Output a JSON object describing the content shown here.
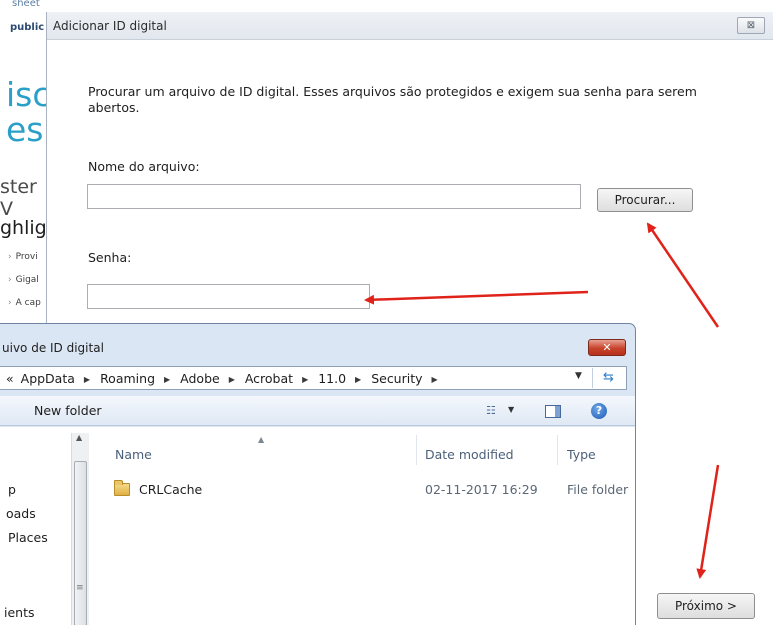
{
  "background_page": {
    "sheet": "sheet",
    "public": "public",
    "heading_line1": "isc",
    "heading_line2": "es",
    "subheading": "ster V",
    "highlights": "ghlig",
    "bullets": [
      "Provi",
      "Gigal",
      "A cap"
    ]
  },
  "dialog": {
    "title": "Adicionar ID digital",
    "close_glyph": "⊠",
    "description": "Procurar um arquivo de ID digital. Esses arquivos são protegidos e exigem sua senha para serem abertos.",
    "filename_label": "Nome do arquivo:",
    "filename_value": "",
    "browse_button": "Procurar...",
    "password_label": "Senha:",
    "password_value": "",
    "next_button": "Próximo >"
  },
  "explorer": {
    "title": "uivo de ID digital",
    "close_glyph": "✕",
    "breadcrumb": [
      "«",
      "AppData",
      "Roaming",
      "Adobe",
      "Acrobat",
      "11.0",
      "Security"
    ],
    "new_folder": "New folder",
    "nav_items": [
      "p",
      "oads",
      "Places",
      "ients"
    ],
    "columns": {
      "name": "Name",
      "date_modified": "Date modified",
      "type": "Type"
    },
    "files": [
      {
        "name": "CRLCache",
        "date_modified": "02-11-2017 16:29",
        "type": "File folder"
      }
    ]
  },
  "colors": {
    "annotation": "#e0231a",
    "accent": "#2aa0c8",
    "close_red": "#c7432b"
  },
  "icons": [
    "close-icon",
    "folder-icon",
    "refresh-icon",
    "view-icon",
    "preview-pane-icon",
    "help-icon",
    "chevron-down-icon",
    "scroll-up-icon",
    "sort-arrow-icon"
  ]
}
